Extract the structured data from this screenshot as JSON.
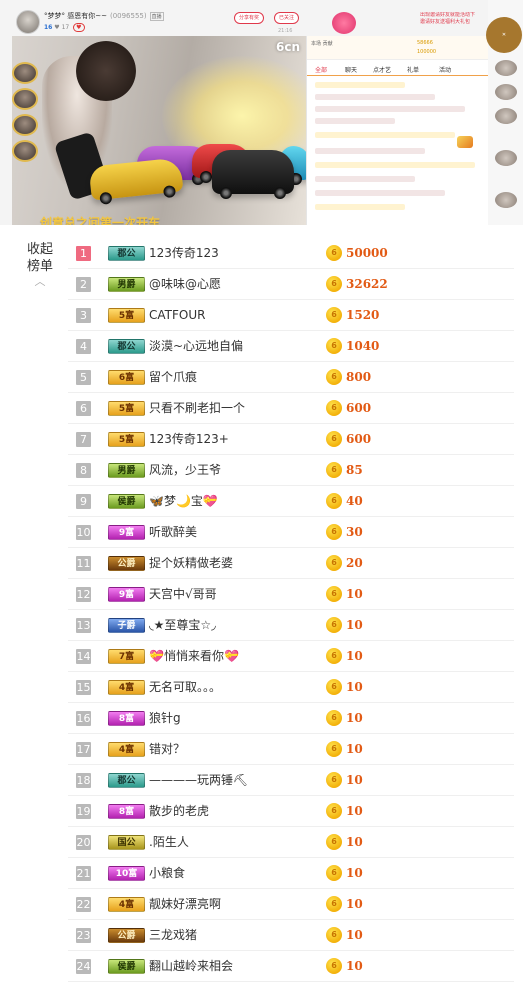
{
  "room": {
    "streamer_name": "°梦梦° 感恩有你~~",
    "room_number": "(0096555)",
    "tag": "直播",
    "level": "16",
    "watch_count": "17",
    "follow_button": "分享有奖",
    "share_button": "已关注",
    "sub_info": "21:16",
    "video_logo": "6cn",
    "video_caption": "创意总之间第一次开车"
  },
  "promo": {
    "text_line1": "出现邀请好友就能活动下",
    "text_line2": "邀请好友送福利大礼包",
    "close_label": "关闭",
    "badge_label": "直播特权"
  },
  "side_panel": {
    "tabs": [
      "全部",
      "聊天",
      "点才艺",
      "礼单",
      "活动"
    ],
    "active_tab": "全部",
    "header_text": "本场 贡献",
    "coin_a": "58666",
    "coin_b": "100000"
  },
  "rank_toggle": {
    "label_line1": "收起",
    "label_line2": "榜单",
    "chevron_icon": "chevron-up-icon"
  },
  "rank_list": [
    {
      "rank": "1",
      "badge": "郡公",
      "badge_style": "dugong",
      "name": "123传奇123",
      "amount": "50000"
    },
    {
      "rank": "2",
      "badge": "男爵",
      "badge_style": "houjue",
      "name": "@味味@心愿",
      "amount": "32622"
    },
    {
      "rank": "3",
      "badge": "5富",
      "badge_style": "fu",
      "name": "CATFOUR",
      "amount": "1520"
    },
    {
      "rank": "4",
      "badge": "郡公",
      "badge_style": "dugong",
      "name": "淡漠~心远地自偏",
      "amount": "1040"
    },
    {
      "rank": "5",
      "badge": "6富",
      "badge_style": "fu",
      "name": "留个爪痕",
      "amount": "800"
    },
    {
      "rank": "6",
      "badge": "5富",
      "badge_style": "fu",
      "name": "只看不刷老扣一个",
      "amount": "600"
    },
    {
      "rank": "7",
      "badge": "5富",
      "badge_style": "fu",
      "name": "123传奇123+",
      "amount": "600"
    },
    {
      "rank": "8",
      "badge": "男爵",
      "badge_style": "houjue",
      "name": "风流，少王爷",
      "amount": "85"
    },
    {
      "rank": "9",
      "badge": "侯爵",
      "badge_style": "houjue",
      "name": "🦋梦🌙宝💝",
      "amount": "40"
    },
    {
      "rank": "10",
      "badge": "9富",
      "badge_style": "purple",
      "name": "听歌醉美",
      "amount": "30"
    },
    {
      "rank": "11",
      "badge": "公爵",
      "badge_style": "gongjue",
      "name": "捉个妖精做老婆",
      "amount": "20"
    },
    {
      "rank": "12",
      "badge": "9富",
      "badge_style": "purple",
      "name": "天宫中√哥哥",
      "amount": "10"
    },
    {
      "rank": "13",
      "badge": "子爵",
      "badge_style": "zijue",
      "name": "◟★至尊宝☆◞",
      "amount": "10"
    },
    {
      "rank": "14",
      "badge": "7富",
      "badge_style": "fu",
      "name": "💝悄悄来看你💝",
      "amount": "10"
    },
    {
      "rank": "15",
      "badge": "4富",
      "badge_style": "fu",
      "name": "无名可取。。。",
      "amount": "10"
    },
    {
      "rank": "16",
      "badge": "8富",
      "badge_style": "purple",
      "name": "狼针g",
      "amount": "10"
    },
    {
      "rank": "17",
      "badge": "4富",
      "badge_style": "fu",
      "name": "错对？",
      "amount": "10"
    },
    {
      "rank": "18",
      "badge": "郡公",
      "badge_style": "dugong",
      "name": "————玩两锤⛏",
      "amount": "10"
    },
    {
      "rank": "19",
      "badge": "8富",
      "badge_style": "purple",
      "name": "散步的老虎",
      "amount": "10"
    },
    {
      "rank": "20",
      "badge": "国公",
      "badge_style": "guogong",
      "name": ".陌生人",
      "amount": "10"
    },
    {
      "rank": "21",
      "badge": "10富",
      "badge_style": "purple",
      "name": "小粮食",
      "amount": "10"
    },
    {
      "rank": "22",
      "badge": "4富",
      "badge_style": "fu",
      "name": "靓妹好漂亮啊",
      "amount": "10"
    },
    {
      "rank": "23",
      "badge": "公爵",
      "badge_style": "gongjue",
      "name": "三龙戏猪",
      "amount": "10"
    },
    {
      "rank": "24",
      "badge": "侯爵",
      "badge_style": "houjue",
      "name": "翻山越岭来相会",
      "amount": "10"
    }
  ],
  "coin_icon": "coin-icon",
  "colors": {
    "amount": "#e25a14",
    "top_rank": "#ef6a80",
    "rank": "#b9b9b9",
    "accent": "#e0394b"
  }
}
